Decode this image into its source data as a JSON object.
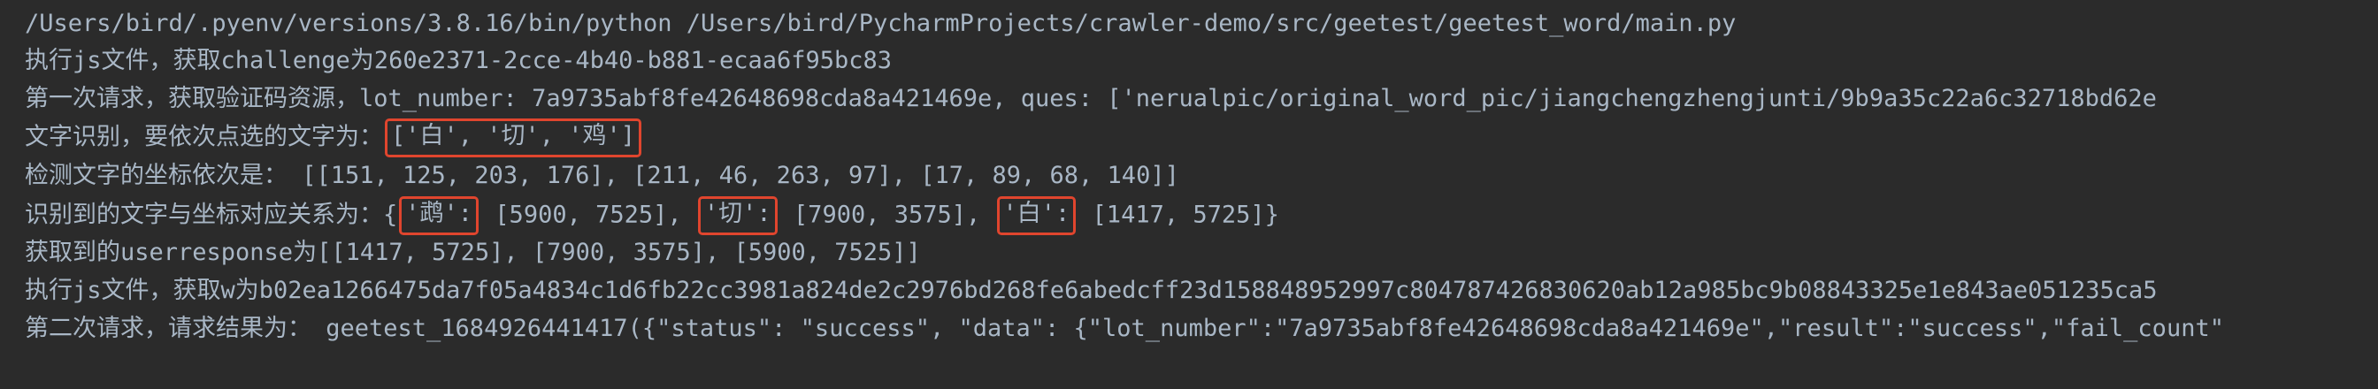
{
  "console": {
    "lines": {
      "interpreter": "/Users/bird/.pyenv/versions/3.8.16/bin/python /Users/bird/PycharmProjects/crawler-demo/src/geetest/geetest_word/main.py",
      "challenge": "执行js文件，获取challenge为260e2371-2cce-4b40-b881-ecaa6f95bc83",
      "first_request": "第一次请求，获取验证码资源，lot_number: 7a9735abf8fe42648698cda8a421469e, ques: ['nerualpic/original_word_pic/jiangchengzhengjunti/9b9a35c22a6c32718bd62e",
      "word_recognition": {
        "prefix": "文字识别，要依次点选的文字为：",
        "highlight": "['白', '切', '鸡']"
      },
      "coordinates": "检测文字的坐标依次是： [[151, 125, 203, 176], [211, 46, 263, 97], [17, 89, 68, 140]]",
      "mapping": {
        "prefix": "识别到的文字与坐标对应关系为：{",
        "hl1": "'鹉':",
        "v1": " [5900, 7525], ",
        "hl2": "'切':",
        "v2": " [7900, 3575], ",
        "hl3": "'白':",
        "v3": " [1417, 5725]}"
      },
      "userresponse": "获取到的userresponse为[[1417, 5725], [7900, 3575], [5900, 7525]]",
      "w_value": "执行js文件，获取w为b02ea1266475da7f05a4834c1d6fb22cc3981a824de2c2976bd268fe6abedcff23d158848952997c804787426830620ab12a985bc9b08843325e1e843ae051235ca5",
      "second_request": "第二次请求，请求结果为： geetest_1684926441417({\"status\": \"success\", \"data\": {\"lot_number\":\"7a9735abf8fe42648698cda8a421469e\",\"result\":\"success\",\"fail_count\""
    }
  },
  "colors": {
    "background": "#2b2b2b",
    "text": "#a9b7c6",
    "highlight_border": "#e0452e"
  }
}
